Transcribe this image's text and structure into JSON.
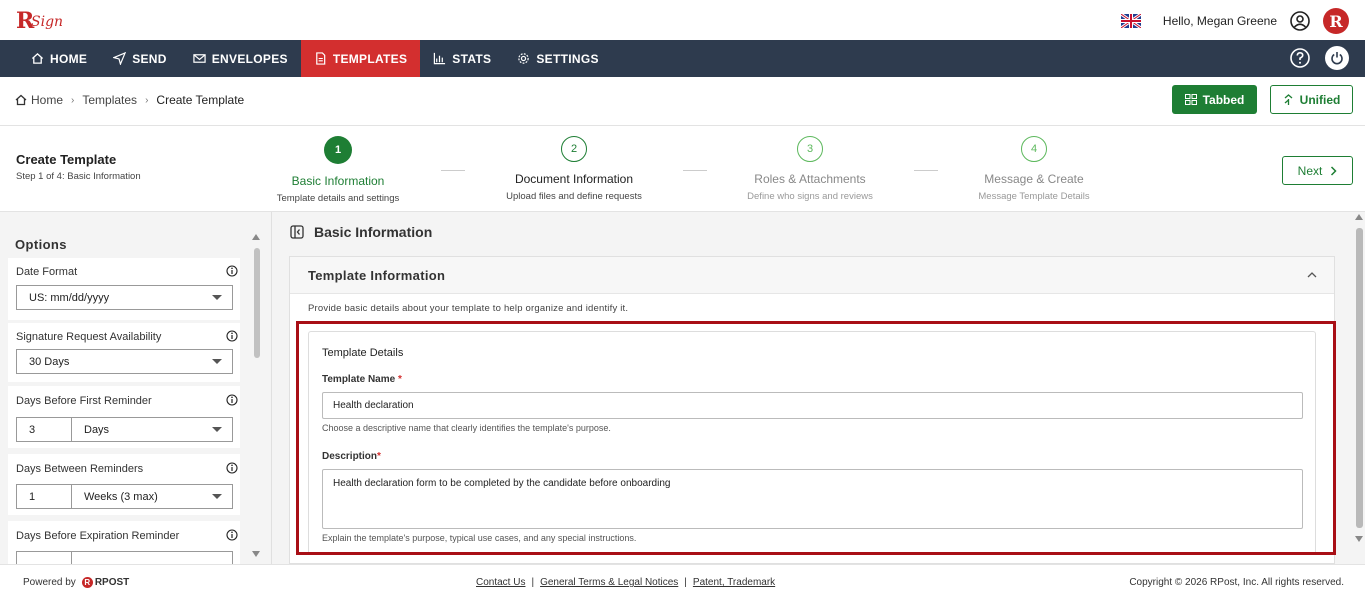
{
  "app": {
    "logo_text": "RSign"
  },
  "user": {
    "greeting": "Hello, Megan Greene"
  },
  "nav": {
    "items": [
      {
        "label": "HOME",
        "icon": "home-icon"
      },
      {
        "label": "SEND",
        "icon": "send-icon"
      },
      {
        "label": "ENVELOPES",
        "icon": "envelope-icon"
      },
      {
        "label": "TEMPLATES",
        "icon": "template-icon",
        "active": true
      },
      {
        "label": "STATS",
        "icon": "stats-icon"
      },
      {
        "label": "SETTINGS",
        "icon": "gear-icon"
      }
    ]
  },
  "breadcrumb": {
    "home": "Home",
    "templates": "Templates",
    "current": "Create Template"
  },
  "view_toggle": {
    "tabbed": "Tabbed",
    "unified": "Unified"
  },
  "wizard": {
    "title": "Create Template",
    "subtitle": "Step 1 of 4: Basic Information",
    "next_label": "Next",
    "steps": [
      {
        "num": "1",
        "label": "Basic Information",
        "desc": "Template details and settings"
      },
      {
        "num": "2",
        "label": "Document Information",
        "desc": "Upload files and define requests"
      },
      {
        "num": "3",
        "label": "Roles & Attachments",
        "desc": "Define who signs and reviews"
      },
      {
        "num": "4",
        "label": "Message & Create",
        "desc": "Message Template Details"
      }
    ]
  },
  "options": {
    "title": "Options",
    "date_format": {
      "label": "Date Format",
      "value": "US: mm/dd/yyyy"
    },
    "availability": {
      "label": "Signature Request Availability",
      "value": "30 Days"
    },
    "first_reminder": {
      "label": "Days Before First Reminder",
      "num": "3",
      "unit": "Days"
    },
    "between_reminders": {
      "label": "Days Between Reminders",
      "num": "1",
      "unit": "Weeks (3 max)"
    },
    "expiration_reminder": {
      "label": "Days Before Expiration Reminder"
    }
  },
  "main": {
    "section_title": "Basic Information",
    "panel_title": "Template Information",
    "panel_desc": "Provide basic details about your template to help organize and identify it.",
    "details_title": "Template Details",
    "name_label": "Template Name",
    "name_value": "Health declaration",
    "name_hint": "Choose a descriptive name that clearly identifies the template's purpose.",
    "desc_label": "Description",
    "desc_value": "Health declaration form to be completed by the candidate before onboarding",
    "desc_hint": "Explain the template's purpose, typical use cases, and any special instructions.",
    "required_mark": "*"
  },
  "footer": {
    "powered_by": "Powered by",
    "brand": "RPOST",
    "links": [
      "Contact Us",
      "General Terms & Legal Notices",
      "Patent, Trademark"
    ],
    "separator": "|",
    "copyright": "Copyright © 2026 RPost, Inc. All rights reserved."
  }
}
